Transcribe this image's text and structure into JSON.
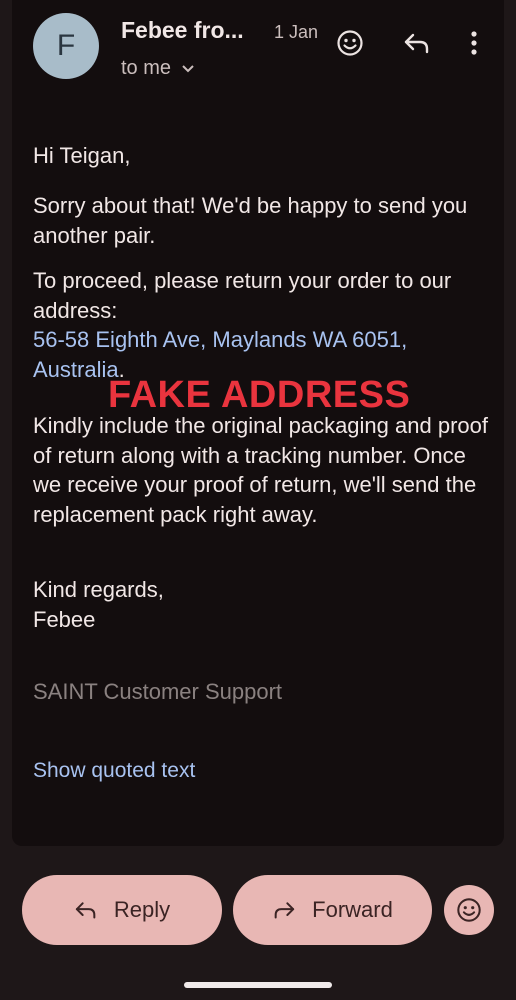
{
  "header": {
    "avatar_letter": "F",
    "sender": "Febee fro...",
    "date": "1 Jan",
    "recipient": "to me"
  },
  "message": {
    "greeting": "Hi Teigan,",
    "para1": "Sorry about that! We'd be happy to send you another pair.",
    "para2_text": "To proceed, please return your order to our address:",
    "address_line1": "56-58 Eighth Ave, Maylands WA 6051,",
    "address_line2": "Australia",
    "address_period": ".",
    "overlay": "FAKE ADDRESS",
    "para3": "Kindly include the original packaging and proof of return along with a tracking number. Once we receive your proof of return, we'll send the replacement pack right away.",
    "closing": "Kind regards,",
    "signature": "Febee",
    "support": "SAINT Customer Support",
    "show_quoted": "Show quoted text"
  },
  "actions": {
    "reply": "Reply",
    "forward": "Forward"
  },
  "colors": {
    "background": "#1e1718",
    "card": "#130d0e",
    "pill": "#e8b7b4",
    "link": "#a8c2f0",
    "overlay": "#e9343e"
  }
}
